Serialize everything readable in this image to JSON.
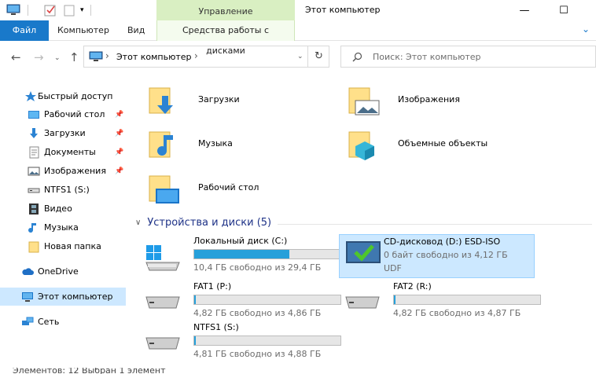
{
  "window": {
    "title": "Этот компьютер",
    "context_group": "Управление",
    "controls": {
      "minimize": "—",
      "maximize": "☐"
    }
  },
  "ribbon": {
    "tabs": [
      {
        "label": "Файл"
      },
      {
        "label": "Компьютер"
      },
      {
        "label": "Вид"
      },
      {
        "label": "Средства работы с дисками"
      }
    ],
    "expand_icon": "⌄"
  },
  "address": {
    "path": "Этот компьютер",
    "separator": "›",
    "search_placeholder": "Поиск: Этот компьютер"
  },
  "sidebar": {
    "items": [
      {
        "label": "Быстрый доступ",
        "icon": "star-icon",
        "pinned": false
      },
      {
        "label": "Рабочий стол",
        "icon": "desktop-icon",
        "pinned": true
      },
      {
        "label": "Загрузки",
        "icon": "download-icon",
        "pinned": true
      },
      {
        "label": "Документы",
        "icon": "documents-icon",
        "pinned": true
      },
      {
        "label": "Изображения",
        "icon": "pictures-icon",
        "pinned": true
      },
      {
        "label": "NTFS1 (S:)",
        "icon": "drive-icon",
        "pinned": false
      },
      {
        "label": "Видео",
        "icon": "video-icon",
        "pinned": false
      },
      {
        "label": "Музыка",
        "icon": "music-icon",
        "pinned": false
      },
      {
        "label": "Новая папка",
        "icon": "folder-icon",
        "pinned": false
      },
      {
        "label": "OneDrive",
        "icon": "cloud-icon",
        "pinned": false
      },
      {
        "label": "Этот компьютер",
        "icon": "computer-icon",
        "pinned": false,
        "selected": true
      },
      {
        "label": "Сеть",
        "icon": "network-icon",
        "pinned": false
      }
    ]
  },
  "folders": [
    {
      "label": "Загрузки",
      "icon": "download-folder-icon"
    },
    {
      "label": "Изображения",
      "icon": "pictures-folder-icon"
    },
    {
      "label": "Музыка",
      "icon": "music-folder-icon"
    },
    {
      "label": "Объемные объекты",
      "icon": "3d-objects-folder-icon"
    },
    {
      "label": "Рабочий стол",
      "icon": "desktop-folder-icon"
    }
  ],
  "drives_group": {
    "title": "Устройства и диски (5)"
  },
  "drives": [
    {
      "name": "Локальный диск (C:)",
      "free": "10,4 ГБ свободно из 29,4 ГБ",
      "used_fraction": 0.65,
      "icon": "windows-drive-icon"
    },
    {
      "name": "CD-дисковод (D:) ESD-ISO",
      "free": "0 байт свободно из 4,12 ГБ",
      "fs": "UDF",
      "icon": "cd-drive-icon",
      "selected": true
    },
    {
      "name": "FAT1 (P:)",
      "free": "4,82 ГБ свободно из 4,86 ГБ",
      "used_fraction": 0.01,
      "icon": "drive-icon"
    },
    {
      "name": "FAT2 (R:)",
      "free": "4,82 ГБ свободно из 4,87 ГБ",
      "used_fraction": 0.01,
      "icon": "drive-icon"
    },
    {
      "name": "NTFS1 (S:)",
      "free": "4,81 ГБ свободно из 4,88 ГБ",
      "used_fraction": 0.01,
      "icon": "drive-icon"
    }
  ],
  "status": {
    "text": "Элементов: 12   Выбран 1 элемент"
  },
  "colors": {
    "accent": "#1979ca",
    "selection": "#cce8ff",
    "progress": "#26a0da",
    "context": "#d9efc2"
  }
}
